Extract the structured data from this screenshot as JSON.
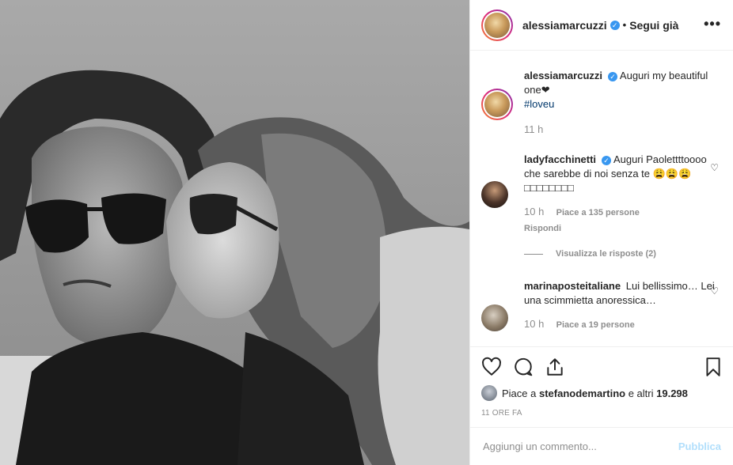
{
  "header": {
    "username": "alessiamarcuzzi",
    "separator": "•",
    "follow_label": "Segui già",
    "more_label": "•••"
  },
  "caption": {
    "username": "alessiamarcuzzi",
    "text": "Auguri my beautiful one❤",
    "hashtag": "#loveu",
    "time": "11 h"
  },
  "comments": [
    {
      "username": "ladyfacchinetti",
      "verified": true,
      "text": "Auguri Paolettttoooo che sarebbe di noi senza te 😩😩😩□□□□□□□□",
      "time": "10 h",
      "likes": "Piace a 135 persone",
      "reply": "Rispondi"
    },
    {
      "username": "marinaposteitaliane",
      "verified": false,
      "text": "Lui bellissimo… Lei una scimmietta anoressica…",
      "time": "10 h",
      "likes": "Piace a 19 persone"
    }
  ],
  "view_replies": "Visualizza le risposte (2)",
  "liked_by": {
    "prefix": "Piace a ",
    "user": "stefanodemartino",
    "mid": " e altri ",
    "count": "19.298"
  },
  "posted_ago": "11 ORE FA",
  "add_comment": {
    "placeholder": "Aggiungi un commento...",
    "publish_label": "Pubblica"
  },
  "colors": {
    "verified": "#3897f0",
    "publish_disabled": "#b2dffc",
    "meta_gray": "#8e8e8e",
    "hashtag": "#00376b"
  }
}
